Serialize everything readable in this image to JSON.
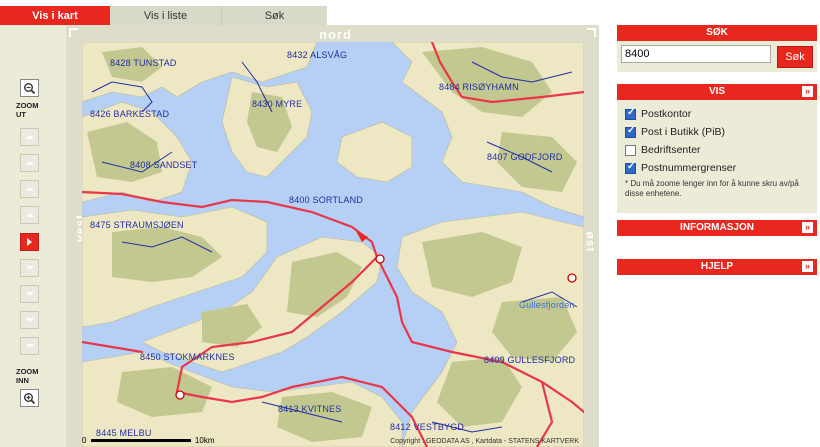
{
  "tabs": [
    {
      "label": "Vis i kart"
    },
    {
      "label": "Vis i liste"
    },
    {
      "label": "Søk"
    }
  ],
  "zoom": {
    "out_label": "ZOOM UT",
    "in_label": "ZOOM INN",
    "level": 4,
    "levels": 9
  },
  "compass": {
    "north": "nord",
    "west": "vest",
    "east": "øst"
  },
  "map": {
    "places": [
      {
        "label": "8428 TUNSTAD"
      },
      {
        "label": "8432 ALSVÅG"
      },
      {
        "label": "8484 RISØYHAMN"
      },
      {
        "label": "8426 BARKESTAD"
      },
      {
        "label": "8430 MYRE"
      },
      {
        "label": "8408 SANDSET"
      },
      {
        "label": "8407 GODFJORD"
      },
      {
        "label": "8400 SORTLAND"
      },
      {
        "label": "8475 STRAUMSJØEN"
      },
      {
        "label": "Gullesfjorden"
      },
      {
        "label": "8450 STOKMARKNES"
      },
      {
        "label": "8409 GULLESFJORD"
      },
      {
        "label": "8413 KVITNES"
      },
      {
        "label": "8412 VESTBYGD"
      },
      {
        "label": "8445 MELBU"
      }
    ],
    "scale_start": "0",
    "scale_end": "10km",
    "copyright": "Copyright : GEODATA AS , Kartdata - STATENS KARTVERK"
  },
  "search": {
    "header": "SØK",
    "value": "8400",
    "button": "Søk"
  },
  "vis": {
    "header": "VIS",
    "options": [
      {
        "label": "Postkontor",
        "checked": true
      },
      {
        "label": "Post i Butikk (PiB)",
        "checked": true
      },
      {
        "label": "Bedriftsenter",
        "checked": false
      },
      {
        "label": "Postnummergrenser",
        "checked": true
      }
    ],
    "note": "* Du må zoome lenger inn for å kunne skru av/på disse enhetene."
  },
  "info": {
    "header": "INFORMASJON"
  },
  "help": {
    "header": "HJELP"
  },
  "colors": {
    "accent": "#e8271f",
    "water": "#b5cff5",
    "land": "#ede7c4",
    "green": "#c3c890",
    "road": "#e8374a"
  }
}
